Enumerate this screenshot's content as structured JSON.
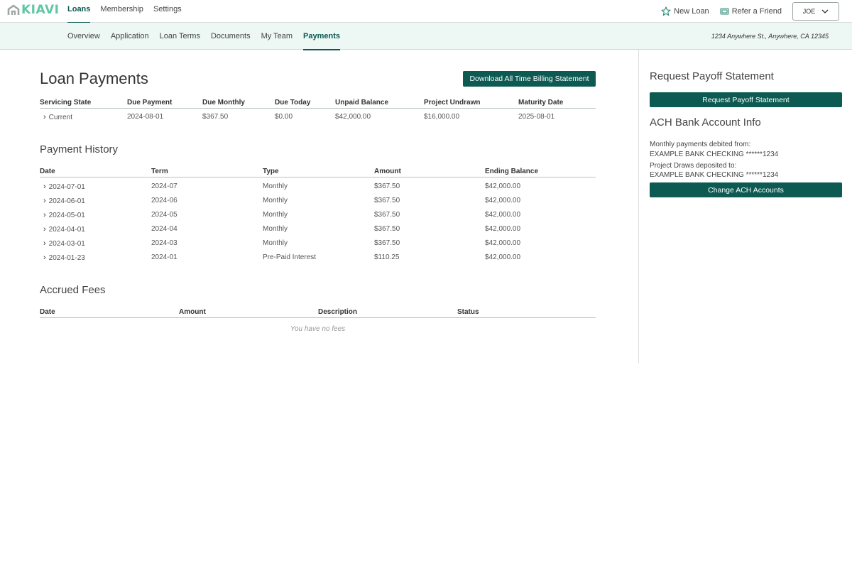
{
  "brand": {
    "name": "KIAVI",
    "color": "#5fc7a4",
    "accent": "#0c5a52"
  },
  "topnav": {
    "links": [
      {
        "label": "Loans",
        "active": true
      },
      {
        "label": "Membership",
        "active": false
      },
      {
        "label": "Settings",
        "active": false
      }
    ],
    "new_loan": "New Loan",
    "refer": "Refer a Friend",
    "user": "JOE"
  },
  "subnav": {
    "tabs": [
      {
        "label": "Overview"
      },
      {
        "label": "Application"
      },
      {
        "label": "Loan Terms"
      },
      {
        "label": "Documents"
      },
      {
        "label": "My Team"
      },
      {
        "label": "Payments",
        "active": true
      }
    ],
    "address": "1234 Anywhere St., Anywhere, CA 12345"
  },
  "main": {
    "title": "Loan Payments",
    "download_button": "Download All Time Billing Statement",
    "servicing": {
      "headers": [
        "Servicing State",
        "Due Payment",
        "Due Monthly",
        "Due Today",
        "Unpaid Balance",
        "Project Undrawn",
        "Maturity Date"
      ],
      "row": [
        "Current",
        "2024-08-01",
        "$367.50",
        "$0.00",
        "$42,000.00",
        "$16,000.00",
        "2025-08-01"
      ]
    },
    "history": {
      "title": "Payment History",
      "headers": [
        "Date",
        "Term",
        "Type",
        "Amount",
        "Ending Balance"
      ],
      "rows": [
        [
          "2024-07-01",
          "2024-07",
          "Monthly",
          "$367.50",
          "$42,000.00"
        ],
        [
          "2024-06-01",
          "2024-06",
          "Monthly",
          "$367.50",
          "$42,000.00"
        ],
        [
          "2024-05-01",
          "2024-05",
          "Monthly",
          "$367.50",
          "$42,000.00"
        ],
        [
          "2024-04-01",
          "2024-04",
          "Monthly",
          "$367.50",
          "$42,000.00"
        ],
        [
          "2024-03-01",
          "2024-03",
          "Monthly",
          "$367.50",
          "$42,000.00"
        ],
        [
          "2024-01-23",
          "2024-01",
          "Pre-Paid Interest",
          "$110.25",
          "$42,000.00"
        ]
      ]
    },
    "fees": {
      "title": "Accrued Fees",
      "headers": [
        "Date",
        "Amount",
        "Description",
        "Status"
      ],
      "empty": "You have no fees"
    }
  },
  "sidebar": {
    "payoff_title": "Request Payoff Statement",
    "payoff_button": "Request Payoff Statement",
    "ach_title": "ACH Bank Account Info",
    "debit_label": "Monthly payments debited from:",
    "debit_account": "EXAMPLE BANK CHECKING ******1234",
    "deposit_label": "Project Draws deposited to:",
    "deposit_account": "EXAMPLE BANK CHECKING ******1234",
    "change_button": "Change ACH Accounts"
  }
}
